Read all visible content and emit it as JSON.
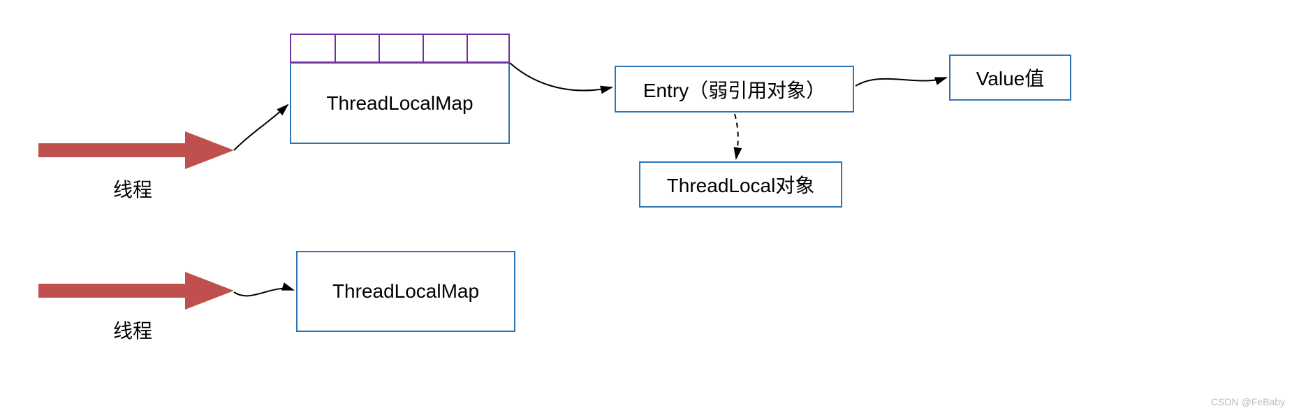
{
  "threadLabel1": "线程",
  "threadLabel2": "线程",
  "mapBox1": "ThreadLocalMap",
  "mapBox2": "ThreadLocalMap",
  "entryBox": "Entry（弱引用对象）",
  "valueBox": "Value值",
  "threadLocalBox": "ThreadLocal对象",
  "watermark": "CSDN @FeBaby",
  "colors": {
    "boxBorder": "#2e75b6",
    "cellBorder": "#7030a0",
    "arrowRed": "#c0504d",
    "connector": "#000000"
  }
}
